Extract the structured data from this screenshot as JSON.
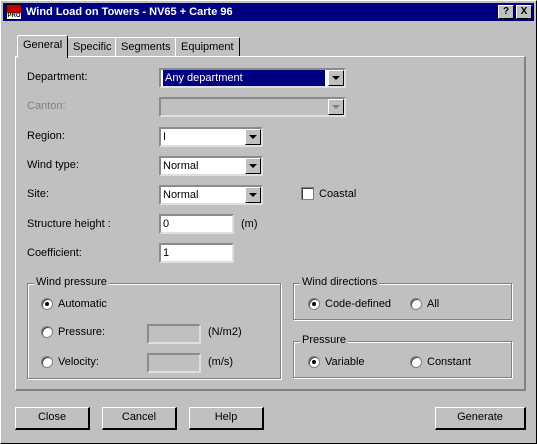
{
  "window": {
    "title": "Wind Load on Towers - NV65 + Carte 96",
    "icon_text": "PRO",
    "help_btn": "?",
    "close_btn": "X"
  },
  "tabs": [
    {
      "label": "General",
      "active": true
    },
    {
      "label": "Specific",
      "active": false
    },
    {
      "label": "Segments",
      "active": false
    },
    {
      "label": "Equipment",
      "active": false
    }
  ],
  "form": {
    "department": {
      "label": "Department:",
      "value": "Any department"
    },
    "canton": {
      "label": "Canton:",
      "value": ""
    },
    "region": {
      "label": "Region:",
      "value": "I"
    },
    "wind_type": {
      "label": "Wind type:",
      "value": "Normal"
    },
    "site": {
      "label": "Site:",
      "value": "Normal"
    },
    "coastal": {
      "label": "Coastal",
      "checked": false
    },
    "structure_height": {
      "label": "Structure height :",
      "value": "0",
      "unit": "(m)"
    },
    "coefficient": {
      "label": "Coefficient:",
      "value": "1"
    }
  },
  "wind_pressure": {
    "title": "Wind pressure",
    "automatic": {
      "label": "Automatic",
      "selected": true
    },
    "pressure": {
      "label": "Pressure:",
      "unit": "(N/m2)",
      "selected": false
    },
    "velocity": {
      "label": "Velocity:",
      "unit": "(m/s)",
      "selected": false
    }
  },
  "wind_directions": {
    "title": "Wind directions",
    "code_defined": {
      "label": "Code-defined",
      "selected": true
    },
    "all": {
      "label": "All",
      "selected": false
    }
  },
  "pressure_group": {
    "title": "Pressure",
    "variable": {
      "label": "Variable",
      "selected": true
    },
    "constant": {
      "label": "Constant",
      "selected": false
    }
  },
  "buttons": {
    "close": "Close",
    "cancel": "Cancel",
    "help": "Help",
    "generate": "Generate"
  }
}
